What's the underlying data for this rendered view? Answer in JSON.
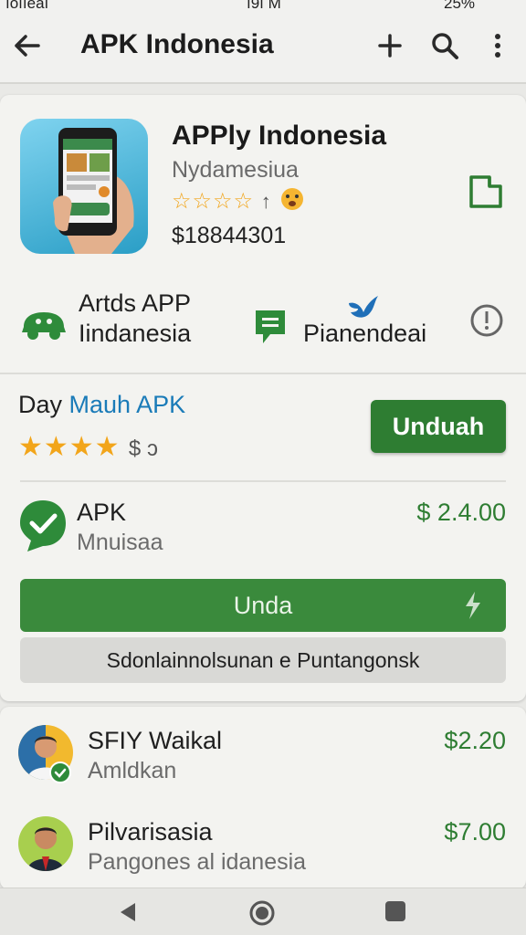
{
  "status_bar": {
    "carrier": "ıoııeaı",
    "time": "ı9ı M",
    "battery": "25%"
  },
  "app_bar": {
    "title": "APK Indonesia"
  },
  "app": {
    "name": "APPly Indonesia",
    "developer": "Nydamesiua",
    "rating_stars": "☆☆☆☆",
    "rating_suffix": "↑",
    "price": "$18844301"
  },
  "features": {
    "item1_line1": "Artds APP",
    "item1_line2": "Iindanesia",
    "item2_label": "Pianendeai"
  },
  "offer": {
    "label_plain": "Day",
    "label_accent": "Mauh APK",
    "stars": "★★★★",
    "stars_suffix": "$ ɔ",
    "download_button": "Unduah"
  },
  "apk_item": {
    "title": "APK",
    "subtitle": "Mnuisaa",
    "price": "$ 2.4.00"
  },
  "buttons": {
    "wide": "Unda",
    "secondary": "Sdonlainnolsunan e Puntangonsk"
  },
  "people": [
    {
      "name": "SFIY Waikal",
      "subtitle": "Amldkan",
      "price": "$2.20"
    },
    {
      "name": "Pilvarisasia",
      "subtitle": "Pangones al idanesia",
      "price": "$7.00"
    }
  ],
  "colors": {
    "accent_green": "#2e7d32",
    "link_blue": "#1a7bb8",
    "star_orange": "#f2a51a"
  },
  "icons": {
    "back": "arrow-left-icon",
    "add": "plus-icon",
    "search": "search-icon",
    "more": "more-vert-icon",
    "bookmark": "bookmark-icon",
    "car": "car-icon",
    "chat": "chat-bubble-icon",
    "bird": "bird-icon",
    "info": "info-icon",
    "verified": "check-badge-icon",
    "bolt": "bolt-icon",
    "nav_back": "nav-back-icon",
    "nav_home": "nav-home-icon",
    "nav_recent": "nav-recent-icon"
  }
}
